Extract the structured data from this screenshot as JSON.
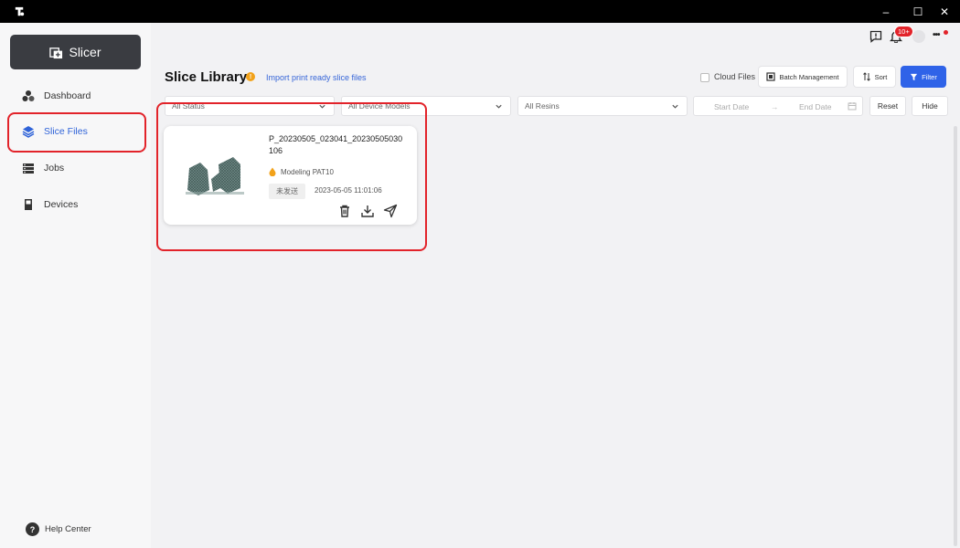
{
  "window": {
    "logo_icon": "app-logo-icon",
    "minimize_label": "–",
    "maximize_label": "☐",
    "close_label": "✕"
  },
  "sidebar": {
    "app_button_label": "Slicer",
    "items": [
      {
        "label": "Dashboard",
        "icon": "dashboard-icon",
        "active": false
      },
      {
        "label": "Slice Files",
        "icon": "layers-icon",
        "active": true
      },
      {
        "label": "Jobs",
        "icon": "jobs-icon",
        "active": false
      },
      {
        "label": "Devices",
        "icon": "device-icon",
        "active": false
      }
    ],
    "help_label": "Help Center"
  },
  "header": {
    "notification_badge": "10+",
    "more_label": "•••"
  },
  "main": {
    "title": "Slice Library",
    "info_symbol": "!",
    "import_link": "Import print ready slice files",
    "cloud_files_label": "Cloud Files",
    "batch_management_label": "Batch Management",
    "sort_label": "Sort",
    "filter_label": "Filter"
  },
  "filters": {
    "status_value": "All Status",
    "device_models_value": "All Device Models",
    "resins_value": "All Resins",
    "start_date_placeholder": "Start Date",
    "end_date_placeholder": "End Date",
    "reset_label": "Reset",
    "hide_label": "Hide"
  },
  "files": [
    {
      "name": "P_20230505_023041_20230505030106",
      "resin": "Modeling PAT10",
      "status": "未发送",
      "date": "2023-05-05 11:01:06"
    }
  ],
  "colors": {
    "accent": "#2f63e8",
    "highlight": "#e2232a",
    "sidebar_button": "#3a3c41",
    "resin_dot": "#f2a21a"
  }
}
